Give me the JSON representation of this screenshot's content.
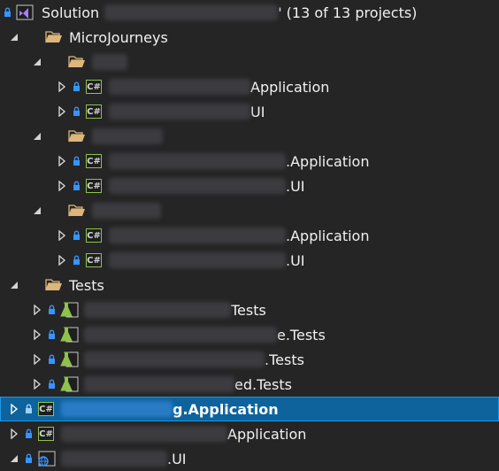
{
  "solution": {
    "label_prefix": "Solution",
    "label_suffix": "' (13 of 13 projects)"
  },
  "tree": {
    "micro_journeys": "MicroJourneys",
    "tests_folder": "Tests",
    "row_app_1": "Application",
    "row_ui_1": "UI",
    "row_app_2": ".Application",
    "row_ui_2": ".UI",
    "row_app_3": ".Application",
    "row_ui_3": ".UI",
    "row_test_1": "Tests",
    "row_test_2": "e.Tests",
    "row_test_3": ".Tests",
    "row_test_4": "ed.Tests",
    "row_selected": "g.Application",
    "row_app_last": "Application",
    "row_ui_last": ".UI",
    "csharp_badge": "C#"
  },
  "colors": {
    "background": "#252526",
    "selection": "#0e639c",
    "folder": "#dcb67a",
    "lock": "#3794ff",
    "test_flask": "#8ec24d"
  }
}
